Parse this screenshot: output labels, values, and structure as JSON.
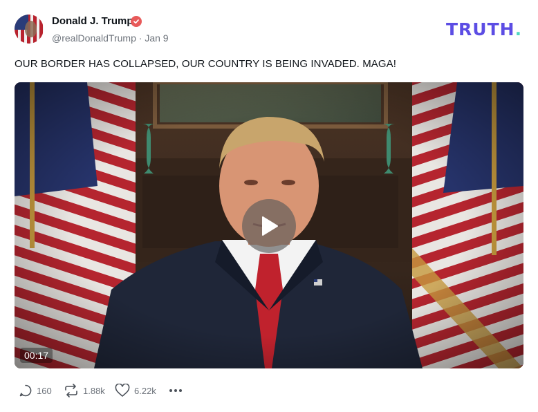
{
  "author": {
    "display_name": "Donald J. Trump",
    "handle": "@realDonaldTrump",
    "separator": "·",
    "date": "Jan 9",
    "verified_icon": "verified-badge-icon"
  },
  "brand": {
    "logo_text": "TRUTH",
    "logo_dot": ".",
    "logo_color": "#5c4de4",
    "dot_color": "#4fd9c0"
  },
  "post": {
    "text": "OUR BORDER HAS COLLAPSED, OUR COUNTRY IS BEING INVADED. MAGA!"
  },
  "video": {
    "duration": "00:17",
    "play_icon": "play-icon"
  },
  "actions": {
    "replies": "160",
    "reposts": "1.88k",
    "likes": "6.22k",
    "more_icon": "ellipsis-icon"
  },
  "colors": {
    "text": "#0f1419",
    "muted": "#6c727a",
    "verified": "#e85a5a"
  }
}
